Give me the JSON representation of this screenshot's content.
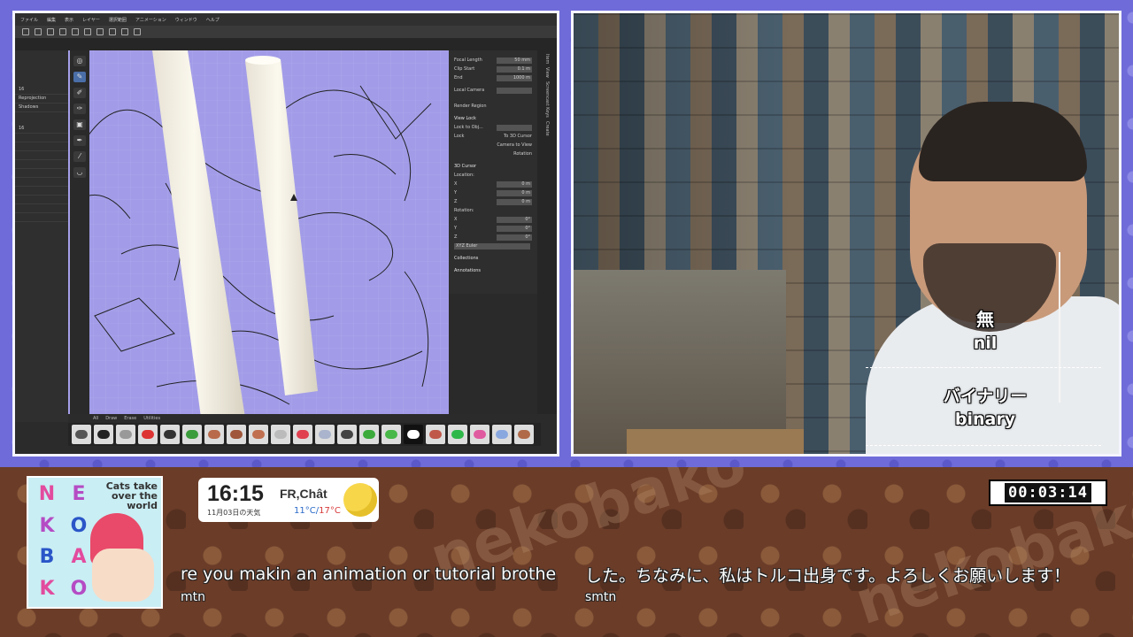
{
  "app": {
    "menu": [
      "ファイル",
      "編集",
      "表示",
      "レイヤー",
      "選択範囲",
      "アニメーション",
      "ウィンドウ",
      "ヘルプ"
    ],
    "left_panel": [
      "16",
      "Reprojection",
      "Shadows",
      "16"
    ],
    "brush_tabs": [
      "All",
      "Draw",
      "Erase",
      "Utilities"
    ],
    "props": {
      "focal_length_label": "Focal Length",
      "focal_length_value": "50 mm",
      "clip_start_label": "Clip Start",
      "clip_start_value": "0.1 m",
      "end_label": "End",
      "end_value": "1000 m",
      "local_camera_label": "Local Camera",
      "render_region_label": "Render Region",
      "view_lock_label": "View Lock",
      "lock_to_object_label": "Lock to Obj...",
      "lock_label": "Lock",
      "to_3d_cursor_label": "To 3D Cursor",
      "camera_to_view_label": "Camera to View",
      "rotation_label": "Rotation",
      "cursor_label": "3D Cursor",
      "location_label": "Location:",
      "x_label": "X",
      "y_label": "Y",
      "z_label": "Z",
      "x_value": "0 m",
      "y_value": "0 m",
      "z_value": "0 m",
      "rotation_header": "Rotation:",
      "rx_value": "0°",
      "ry_value": "0°",
      "rz_value": "0°",
      "euler_label": "XYZ Euler",
      "collections_label": "Collections",
      "annotations_label": "Annotations"
    },
    "side_tabs": [
      "Item",
      "View",
      "Screencast Keys",
      "Create"
    ]
  },
  "captions": {
    "line1": "無",
    "line2": "nil",
    "line3": "バイナリー",
    "line4": "binary"
  },
  "logo": {
    "letters": [
      "N",
      "E",
      "K",
      "O",
      "B",
      "A",
      "K",
      "O"
    ],
    "tagline": "Cats take over the world"
  },
  "weather": {
    "time": "16:15",
    "location": "FR,Chât",
    "date": "11月03日の天気",
    "temp_low": "11°C",
    "temp_sep": "/",
    "temp_high": "17°C"
  },
  "timer": "00:03:14",
  "chat": [
    {
      "message": "re you makin an animation or tutorial brother",
      "user": "mtn"
    },
    {
      "message": "した。ちなみに、私はトルコ出身です。よろしくお願いします！",
      "user": "smtn"
    }
  ],
  "watermark": "nekobako",
  "colors": {
    "frame_border": "#f4f4ff",
    "viewport": "#a29ce8",
    "accent_pink": "#e24b9e",
    "accent_blue": "#2a56c8"
  }
}
